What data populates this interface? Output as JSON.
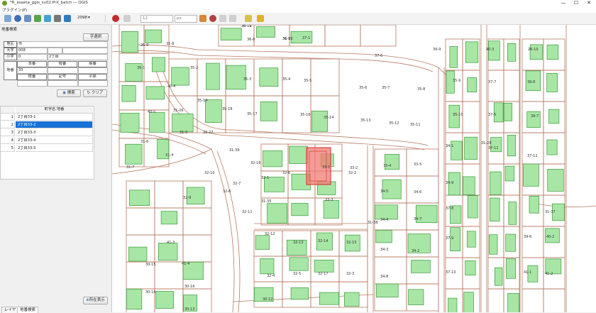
{
  "window": {
    "title": "*R_asaeta_ggis_sv02:PrX_batch — QGIS",
    "minimize": "—",
    "maximize": "☐",
    "close": "✕"
  },
  "menubar": {
    "plugins": "プラグイン(P)"
  },
  "toolbar": {
    "scale_label": "2098",
    "zoom_value": "12",
    "unit_value": "px"
  },
  "panel": {
    "title": "地番検索",
    "shortcut_button": "字選択",
    "district_label": "地区",
    "district_value": "市",
    "oaza_label": "大字",
    "oaza_value": "008",
    "koaza_label": "小字",
    "koaza_value": "0",
    "koaza_name": "2丁目",
    "banchi_label": "地番",
    "col_main": "本番",
    "col_branch": "枝番",
    "col_sub": "孫番",
    "banchi_value": "33",
    "col_branch2": "枝番",
    "col_symbol": "記号",
    "col_grandchild": "子孫",
    "search_button": "検索",
    "clear_button": "クリア",
    "results_header": "町字名  地番",
    "results": [
      {
        "num": "1",
        "text": "2丁目33-1"
      },
      {
        "num": "2",
        "text": "2丁目33-2"
      },
      {
        "num": "3",
        "text": "2丁目33-3"
      },
      {
        "num": "4",
        "text": "2丁目33-4"
      },
      {
        "num": "5",
        "text": "2丁目33-5"
      }
    ],
    "locate_button": "所在表示"
  },
  "bottom_tabs": {
    "layers": "レイヤ",
    "search": "地番検索"
  },
  "map": {
    "colors": {
      "parcel_line": "#b77b62",
      "building_fill": "#a8e6a5",
      "building_line": "#3c9a3c",
      "highlight_fill": "#f17b73",
      "highlight_line": "#d92b2b"
    },
    "labels": [
      "36-10",
      "36-9",
      "36-8",
      "37-1",
      "37-6",
      "39-9",
      "40-3",
      "26-10",
      "26-9",
      "35-1",
      "35-2",
      "35-3",
      "35-4",
      "35-5",
      "35-6",
      "35-7",
      "35-8",
      "35-9",
      "37-7",
      "39-8",
      "40-4",
      "35-19",
      "35-18",
      "35-17",
      "35-16",
      "35-14",
      "35-13",
      "35-12",
      "35-11",
      "35-10",
      "37-5",
      "39-7",
      "40-5",
      "31-5",
      "31-6",
      "31-4",
      "31-7",
      "31-8",
      "31-26",
      "31-27",
      "31-28",
      "31-35",
      "31-37",
      "31-38",
      "31-39",
      "32-10",
      "32-9",
      "32-8",
      "32-7",
      "32-11",
      "32-12",
      "32-13",
      "32-14",
      "32-15",
      "32-16",
      "32-17",
      "32-5",
      "32-4",
      "32-3",
      "32-2",
      "32-1",
      "32-6",
      "33-1",
      "33-2",
      "33-3",
      "33-4",
      "33-5",
      "34-5",
      "34-6",
      "34-4",
      "34-7",
      "34-3",
      "34-8",
      "34-2",
      "34-1",
      "34-9",
      "37-8",
      "37-9",
      "37-10",
      "37-11",
      "37-12",
      "39-6",
      "40-2",
      "41-1",
      "41-2",
      "41-3",
      "41-4",
      "30-16",
      "30-15",
      "30-14",
      "30-13",
      "30-12",
      "30-11",
      "31-29"
    ]
  }
}
